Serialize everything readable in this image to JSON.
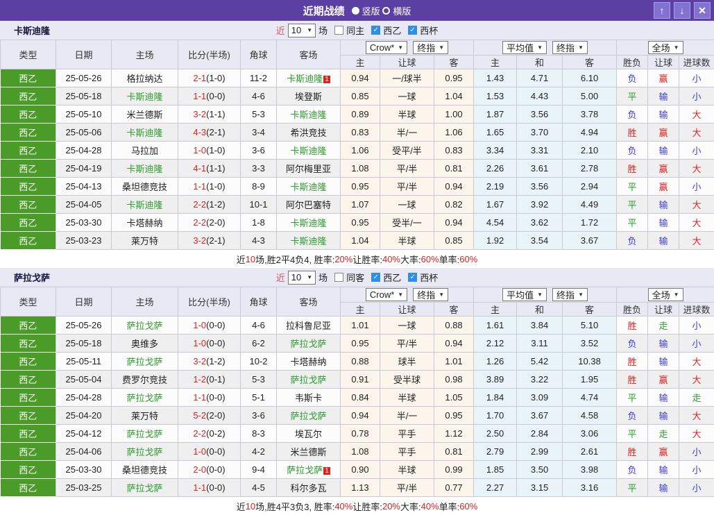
{
  "colors": {
    "titlebar_bg": "#5b3fa3",
    "titlebar_button_bg": "#8173cf",
    "panel_bg": "#e9e9f5",
    "type_cell_green": "#4a9b28",
    "team_green": "#2e9b2e",
    "accent_red": "#dd2222",
    "accent_blue": "#3c3cd4",
    "accent_green": "#2e9b2e",
    "crow_col_bg": "#fbf5ec",
    "avg_col_bg": "#e9f4f8",
    "checkbox_checked": "#2e8ee8"
  },
  "titlebar": {
    "title": "近期战绩",
    "options": [
      {
        "label": "竖版",
        "selected": true
      },
      {
        "label": "横版",
        "selected": false
      }
    ],
    "buttons": {
      "up": "↑",
      "down": "↓",
      "close": "✕"
    }
  },
  "table_header": {
    "cols": {
      "type": "类型",
      "date": "日期",
      "home": "主场",
      "score": "比分(半场)",
      "corner": "角球",
      "away": "客场"
    },
    "dropdowns": {
      "crow": "Crow*",
      "final1": "终指",
      "avg": "平均值",
      "final2": "终指",
      "full": "全场"
    },
    "sub": {
      "home": "主",
      "handicap": "让球",
      "away": "客",
      "avg_home": "主",
      "avg_draw": "和",
      "avg_away": "客",
      "result": "胜负",
      "handicap_result": "让球",
      "goals": "进球数"
    }
  },
  "sections": [
    {
      "team": "卡斯迪隆",
      "controls": {
        "near": "近",
        "count": "10",
        "matches_label": "场",
        "same_label": "同主",
        "same_checked": false,
        "league_label": "西乙",
        "league_checked": true,
        "cup_label": "西杯",
        "cup_checked": true
      },
      "rows": [
        {
          "type": "西乙",
          "date": "25-05-26",
          "home": "格拉纳达",
          "home_green": false,
          "score": "2-1",
          "half": "(1-0)",
          "corner": "11-2",
          "away": "卡斯迪隆",
          "away_green": true,
          "away_badge": "1",
          "odds": [
            "0.94",
            "一/球半",
            "0.95"
          ],
          "avg": [
            "1.43",
            "4.71",
            "6.10"
          ],
          "result": {
            "text": "负",
            "color": "blue"
          },
          "handicap_r": {
            "text": "赢",
            "color": "red"
          },
          "goal_r": {
            "text": "小",
            "color": "blue"
          }
        },
        {
          "type": "西乙",
          "date": "25-05-18",
          "home": "卡斯迪隆",
          "home_green": true,
          "score": "1-1",
          "half": "(0-0)",
          "corner": "4-6",
          "away": "埃登斯",
          "away_green": false,
          "odds": [
            "0.85",
            "一球",
            "1.04"
          ],
          "avg": [
            "1.53",
            "4.43",
            "5.00"
          ],
          "result": {
            "text": "平",
            "color": "green"
          },
          "handicap_r": {
            "text": "输",
            "color": "blue"
          },
          "goal_r": {
            "text": "小",
            "color": "blue"
          }
        },
        {
          "type": "西乙",
          "date": "25-05-10",
          "home": "米兰德斯",
          "home_green": false,
          "score": "3-2",
          "half": "(1-1)",
          "corner": "5-3",
          "away": "卡斯迪隆",
          "away_green": true,
          "odds": [
            "0.89",
            "半球",
            "1.00"
          ],
          "avg": [
            "1.87",
            "3.56",
            "3.78"
          ],
          "result": {
            "text": "负",
            "color": "blue"
          },
          "handicap_r": {
            "text": "输",
            "color": "blue"
          },
          "goal_r": {
            "text": "大",
            "color": "red"
          }
        },
        {
          "type": "西乙",
          "date": "25-05-06",
          "home": "卡斯迪隆",
          "home_green": true,
          "score": "4-3",
          "half": "(2-1)",
          "corner": "3-4",
          "away": "希洪竞技",
          "away_green": false,
          "odds": [
            "0.83",
            "半/一",
            "1.06"
          ],
          "avg": [
            "1.65",
            "3.70",
            "4.94"
          ],
          "result": {
            "text": "胜",
            "color": "red"
          },
          "handicap_r": {
            "text": "赢",
            "color": "red"
          },
          "goal_r": {
            "text": "大",
            "color": "red"
          }
        },
        {
          "type": "西乙",
          "date": "25-04-28",
          "home": "马拉加",
          "home_green": false,
          "score": "1-0",
          "half": "(1-0)",
          "corner": "3-6",
          "away": "卡斯迪隆",
          "away_green": true,
          "odds": [
            "1.06",
            "受平/半",
            "0.83"
          ],
          "avg": [
            "3.34",
            "3.31",
            "2.10"
          ],
          "result": {
            "text": "负",
            "color": "blue"
          },
          "handicap_r": {
            "text": "输",
            "color": "blue"
          },
          "goal_r": {
            "text": "小",
            "color": "blue"
          }
        },
        {
          "type": "西乙",
          "date": "25-04-19",
          "home": "卡斯迪隆",
          "home_green": true,
          "score": "4-1",
          "half": "(1-1)",
          "corner": "3-3",
          "away": "阿尔梅里亚",
          "away_green": false,
          "odds": [
            "1.08",
            "平/半",
            "0.81"
          ],
          "avg": [
            "2.26",
            "3.61",
            "2.78"
          ],
          "result": {
            "text": "胜",
            "color": "red"
          },
          "handicap_r": {
            "text": "赢",
            "color": "red"
          },
          "goal_r": {
            "text": "大",
            "color": "red"
          }
        },
        {
          "type": "西乙",
          "date": "25-04-13",
          "home": "桑坦德竞技",
          "home_green": false,
          "score": "1-1",
          "half": "(1-0)",
          "corner": "8-9",
          "away": "卡斯迪隆",
          "away_green": true,
          "odds": [
            "0.95",
            "平/半",
            "0.94"
          ],
          "avg": [
            "2.19",
            "3.56",
            "2.94"
          ],
          "result": {
            "text": "平",
            "color": "green"
          },
          "handicap_r": {
            "text": "赢",
            "color": "red"
          },
          "goal_r": {
            "text": "小",
            "color": "blue"
          }
        },
        {
          "type": "西乙",
          "date": "25-04-05",
          "home": "卡斯迪隆",
          "home_green": true,
          "score": "2-2",
          "half": "(1-2)",
          "corner": "10-1",
          "away": "阿尔巴塞特",
          "away_green": false,
          "odds": [
            "1.07",
            "一球",
            "0.82"
          ],
          "avg": [
            "1.67",
            "3.92",
            "4.49"
          ],
          "result": {
            "text": "平",
            "color": "green"
          },
          "handicap_r": {
            "text": "输",
            "color": "blue"
          },
          "goal_r": {
            "text": "大",
            "color": "red"
          }
        },
        {
          "type": "西乙",
          "date": "25-03-30",
          "home": "卡塔赫纳",
          "home_green": false,
          "score": "2-2",
          "half": "(2-0)",
          "corner": "1-8",
          "away": "卡斯迪隆",
          "away_green": true,
          "odds": [
            "0.95",
            "受半/一",
            "0.94"
          ],
          "avg": [
            "4.54",
            "3.62",
            "1.72"
          ],
          "result": {
            "text": "平",
            "color": "green"
          },
          "handicap_r": {
            "text": "输",
            "color": "blue"
          },
          "goal_r": {
            "text": "大",
            "color": "red"
          }
        },
        {
          "type": "西乙",
          "date": "25-03-23",
          "home": "莱万特",
          "home_green": false,
          "score": "3-2",
          "half": "(2-1)",
          "corner": "4-3",
          "away": "卡斯迪隆",
          "away_green": true,
          "odds": [
            "1.04",
            "半球",
            "0.85"
          ],
          "avg": [
            "1.92",
            "3.54",
            "3.67"
          ],
          "result": {
            "text": "负",
            "color": "blue"
          },
          "handicap_r": {
            "text": "输",
            "color": "blue"
          },
          "goal_r": {
            "text": "大",
            "color": "red"
          }
        }
      ],
      "summary": [
        {
          "text": "近",
          "color": "k"
        },
        {
          "text": "10",
          "color": "r"
        },
        {
          "text": "场,胜2平4负4, 胜率:",
          "color": "k"
        },
        {
          "text": "20%",
          "color": "r"
        },
        {
          "text": " 让胜率:",
          "color": "k"
        },
        {
          "text": "40%",
          "color": "r"
        },
        {
          "text": " 大率:",
          "color": "k"
        },
        {
          "text": "60%",
          "color": "r"
        },
        {
          "text": " 单率:",
          "color": "k"
        },
        {
          "text": "60%",
          "color": "r"
        }
      ]
    },
    {
      "team": "萨拉戈萨",
      "controls": {
        "near": "近",
        "count": "10",
        "matches_label": "场",
        "same_label": "同客",
        "same_checked": false,
        "league_label": "西乙",
        "league_checked": true,
        "cup_label": "西杯",
        "cup_checked": true
      },
      "rows": [
        {
          "type": "西乙",
          "date": "25-05-26",
          "home": "萨拉戈萨",
          "home_green": true,
          "score": "1-0",
          "half": "(0-0)",
          "corner": "4-6",
          "away": "拉科鲁尼亚",
          "away_green": false,
          "odds": [
            "1.01",
            "一球",
            "0.88"
          ],
          "avg": [
            "1.61",
            "3.84",
            "5.10"
          ],
          "result": {
            "text": "胜",
            "color": "red"
          },
          "handicap_r": {
            "text": "走",
            "color": "green"
          },
          "goal_r": {
            "text": "小",
            "color": "blue"
          }
        },
        {
          "type": "西乙",
          "date": "25-05-18",
          "home": "奥维多",
          "home_green": false,
          "score": "1-0",
          "half": "(0-0)",
          "corner": "6-2",
          "away": "萨拉戈萨",
          "away_green": true,
          "odds": [
            "0.95",
            "平/半",
            "0.94"
          ],
          "avg": [
            "2.12",
            "3.11",
            "3.52"
          ],
          "result": {
            "text": "负",
            "color": "blue"
          },
          "handicap_r": {
            "text": "输",
            "color": "blue"
          },
          "goal_r": {
            "text": "小",
            "color": "blue"
          }
        },
        {
          "type": "西乙",
          "date": "25-05-11",
          "home": "萨拉戈萨",
          "home_green": true,
          "score": "3-2",
          "half": "(1-2)",
          "corner": "10-2",
          "away": "卡塔赫纳",
          "away_green": false,
          "odds": [
            "0.88",
            "球半",
            "1.01"
          ],
          "avg": [
            "1.26",
            "5.42",
            "10.38"
          ],
          "result": {
            "text": "胜",
            "color": "red"
          },
          "handicap_r": {
            "text": "输",
            "color": "blue"
          },
          "goal_r": {
            "text": "大",
            "color": "red"
          }
        },
        {
          "type": "西乙",
          "date": "25-05-04",
          "home": "费罗尔竞技",
          "home_green": false,
          "score": "1-2",
          "half": "(0-1)",
          "corner": "5-3",
          "away": "萨拉戈萨",
          "away_green": true,
          "odds": [
            "0.91",
            "受半球",
            "0.98"
          ],
          "avg": [
            "3.89",
            "3.22",
            "1.95"
          ],
          "result": {
            "text": "胜",
            "color": "red"
          },
          "handicap_r": {
            "text": "赢",
            "color": "red"
          },
          "goal_r": {
            "text": "大",
            "color": "red"
          }
        },
        {
          "type": "西乙",
          "date": "25-04-28",
          "home": "萨拉戈萨",
          "home_green": true,
          "score": "1-1",
          "half": "(0-0)",
          "corner": "5-1",
          "away": "韦斯卡",
          "away_green": false,
          "odds": [
            "0.84",
            "半球",
            "1.05"
          ],
          "avg": [
            "1.84",
            "3.09",
            "4.74"
          ],
          "result": {
            "text": "平",
            "color": "green"
          },
          "handicap_r": {
            "text": "输",
            "color": "blue"
          },
          "goal_r": {
            "text": "走",
            "color": "green"
          }
        },
        {
          "type": "西乙",
          "date": "25-04-20",
          "home": "莱万特",
          "home_green": false,
          "score": "5-2",
          "half": "(2-0)",
          "corner": "3-6",
          "away": "萨拉戈萨",
          "away_green": true,
          "odds": [
            "0.94",
            "半/一",
            "0.95"
          ],
          "avg": [
            "1.70",
            "3.67",
            "4.58"
          ],
          "result": {
            "text": "负",
            "color": "blue"
          },
          "handicap_r": {
            "text": "输",
            "color": "blue"
          },
          "goal_r": {
            "text": "大",
            "color": "red"
          }
        },
        {
          "type": "西乙",
          "date": "25-04-12",
          "home": "萨拉戈萨",
          "home_green": true,
          "score": "2-2",
          "half": "(0-2)",
          "corner": "8-3",
          "away": "埃瓦尔",
          "away_green": false,
          "odds": [
            "0.78",
            "平手",
            "1.12"
          ],
          "avg": [
            "2.50",
            "2.84",
            "3.06"
          ],
          "result": {
            "text": "平",
            "color": "green"
          },
          "handicap_r": {
            "text": "走",
            "color": "green"
          },
          "goal_r": {
            "text": "大",
            "color": "red"
          }
        },
        {
          "type": "西乙",
          "date": "25-04-06",
          "home": "萨拉戈萨",
          "home_green": true,
          "score": "1-0",
          "half": "(0-0)",
          "corner": "4-2",
          "away": "米兰德斯",
          "away_green": false,
          "odds": [
            "1.08",
            "平手",
            "0.81"
          ],
          "avg": [
            "2.79",
            "2.99",
            "2.61"
          ],
          "result": {
            "text": "胜",
            "color": "red"
          },
          "handicap_r": {
            "text": "赢",
            "color": "red"
          },
          "goal_r": {
            "text": "小",
            "color": "blue"
          }
        },
        {
          "type": "西乙",
          "date": "25-03-30",
          "home": "桑坦德竞技",
          "home_green": false,
          "score": "2-0",
          "half": "(0-0)",
          "corner": "9-4",
          "away": "萨拉戈萨",
          "away_green": true,
          "away_badge": "1",
          "odds": [
            "0.90",
            "半球",
            "0.99"
          ],
          "avg": [
            "1.85",
            "3.50",
            "3.98"
          ],
          "result": {
            "text": "负",
            "color": "blue"
          },
          "handicap_r": {
            "text": "输",
            "color": "blue"
          },
          "goal_r": {
            "text": "小",
            "color": "blue"
          }
        },
        {
          "type": "西乙",
          "date": "25-03-25",
          "home": "萨拉戈萨",
          "home_green": true,
          "score": "1-1",
          "half": "(0-0)",
          "corner": "4-5",
          "away": "科尔多瓦",
          "away_green": false,
          "odds": [
            "1.13",
            "平/半",
            "0.77"
          ],
          "avg": [
            "2.27",
            "3.15",
            "3.16"
          ],
          "result": {
            "text": "平",
            "color": "green"
          },
          "handicap_r": {
            "text": "输",
            "color": "blue"
          },
          "goal_r": {
            "text": "小",
            "color": "blue"
          }
        }
      ],
      "summary": [
        {
          "text": "近",
          "color": "k"
        },
        {
          "text": "10",
          "color": "r"
        },
        {
          "text": "场,胜4平3负3, 胜率:",
          "color": "k"
        },
        {
          "text": "40%",
          "color": "r"
        },
        {
          "text": " 让胜率:",
          "color": "k"
        },
        {
          "text": "20%",
          "color": "r"
        },
        {
          "text": " 大率:",
          "color": "k"
        },
        {
          "text": "40%",
          "color": "r"
        },
        {
          "text": " 单率:",
          "color": "k"
        },
        {
          "text": "60%",
          "color": "r"
        }
      ]
    }
  ]
}
